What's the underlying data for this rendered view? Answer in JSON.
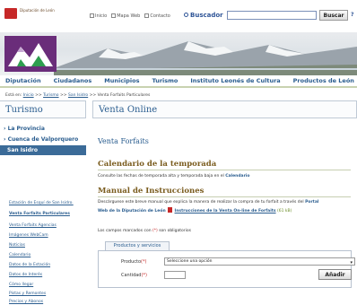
{
  "header": {
    "logo_text": "Diputación de León",
    "links": [
      {
        "icon": "home-icon",
        "label": "Inicio"
      },
      {
        "icon": "sitemap-icon",
        "label": "Mapa Web"
      },
      {
        "icon": "mail-icon",
        "label": "Contacto"
      }
    ],
    "search_label": "Buscador",
    "search_value": "",
    "search_button": "Buscar",
    "help_label": "?"
  },
  "nav": {
    "items": [
      "Diputación",
      "Ciudadanos",
      "Municipios",
      "Turismo",
      "Instituto Leonés de Cultura",
      "Productos de León"
    ]
  },
  "breadcrumb": {
    "prefix": "Está en:",
    "items": [
      "Inicio",
      "Turismo",
      "San Isidro",
      "Venta Forfaits Particulares"
    ],
    "separator": ">>"
  },
  "sidebar": {
    "title": "Turismo",
    "sections": [
      "La Provincia",
      "Cuenca de Valporquero"
    ],
    "active": "San Isidro",
    "subitems": [
      {
        "label": "Estación de Esquí de San Isidro.",
        "bold": false
      },
      {
        "label": "Venta Forfaits Particulares",
        "bold": true
      },
      {
        "label": "Venta Forfaits Agencias",
        "bold": false
      },
      {
        "label": "Imágenes WebCam",
        "bold": false
      },
      {
        "label": "Noticias",
        "bold": false
      },
      {
        "label": "Calendario",
        "bold": false
      },
      {
        "label": "Datos de la Estación",
        "bold": false
      },
      {
        "label": "Datos de Interés",
        "bold": false
      },
      {
        "label": "Cómo llegar",
        "bold": false
      },
      {
        "label": "Pistas y Remontes",
        "bold": false
      },
      {
        "label": "Precios y Abonos",
        "bold": false
      }
    ]
  },
  "main": {
    "title": "Venta Online",
    "section_title": "Venta Forfaits",
    "calendar": {
      "heading": "Calendario de la temporada",
      "text": "Consulte las fechas de temporada alta y temporada baja en el",
      "link": "Calendario"
    },
    "manual": {
      "heading": "Manual de Instrucciones",
      "text_line1": "Descárguese este breve manual que explica la manera de realizar la compra de tu forfait a través del",
      "link_portal": "Portal",
      "text_line2_bold": "Web de la Diputación de León",
      "pdf_link": "Instrucciones de la Venta On-line de Forfaits",
      "size": "(61 kB)"
    },
    "required_note_prefix": "Los campos marcados con",
    "required_mark": "(*)",
    "required_note_suffix": "son obligatorios"
  },
  "form": {
    "tab_label": "Productos y servicios",
    "product_label": "Producto",
    "product_required": "(*)",
    "product_selected": "Seleccione una opción",
    "quantity_label": "Cantidad",
    "quantity_required": "(*)",
    "quantity_value": "",
    "add_button": "Añadir"
  }
}
